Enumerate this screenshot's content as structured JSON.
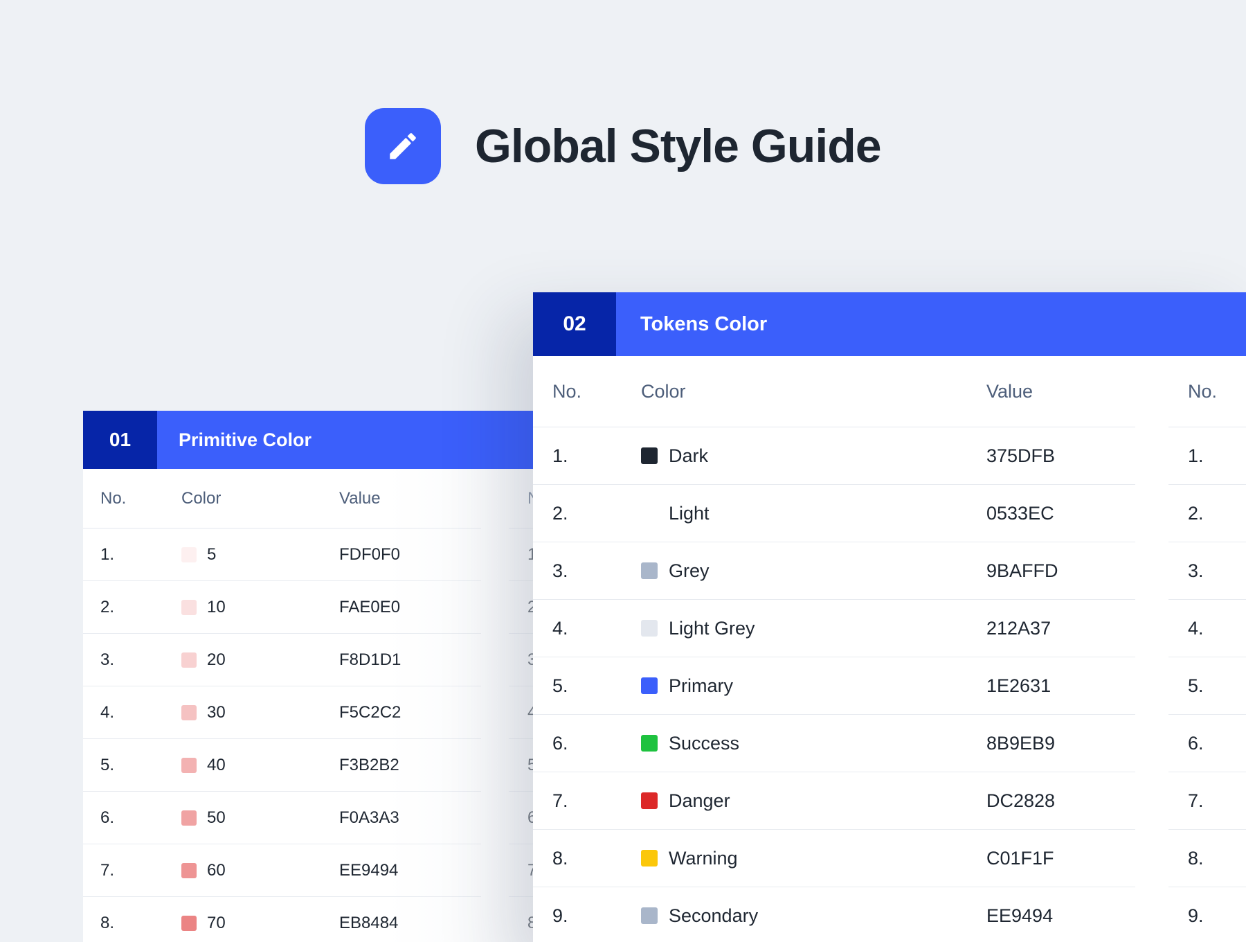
{
  "header": {
    "title": "Global Style Guide",
    "icon": "pencil-icon",
    "icon_bg": "#3b5ffb"
  },
  "primitive": {
    "number": "01",
    "title": "Primitive Color",
    "columns": {
      "no": "No.",
      "color": "Color",
      "value": "Value"
    },
    "rows": [
      {
        "no": "1.",
        "name": "5",
        "value": "FDF0F0",
        "swatch": "#fdf0f0"
      },
      {
        "no": "2.",
        "name": "10",
        "value": "FAE0E0",
        "swatch": "#fae0e0"
      },
      {
        "no": "3.",
        "name": "20",
        "value": "F8D1D1",
        "swatch": "#f8d1d1"
      },
      {
        "no": "4.",
        "name": "30",
        "value": "F5C2C2",
        "swatch": "#f5c2c2"
      },
      {
        "no": "5.",
        "name": "40",
        "value": "F3B2B2",
        "swatch": "#f3b2b2"
      },
      {
        "no": "6.",
        "name": "50",
        "value": "F0A3A3",
        "swatch": "#f0a3a3"
      },
      {
        "no": "7.",
        "name": "60",
        "value": "EE9494",
        "swatch": "#ee9494"
      },
      {
        "no": "8.",
        "name": "70",
        "value": "EB8484",
        "swatch": "#eb8484"
      }
    ],
    "second_table": {
      "header": "N",
      "numbers": [
        "1",
        "2",
        "3",
        "4",
        "5",
        "6",
        "7",
        "8"
      ]
    }
  },
  "tokens": {
    "number": "02",
    "title": "Tokens Color",
    "columns": {
      "no": "No.",
      "color": "Color",
      "value": "Value"
    },
    "rows": [
      {
        "no": "1.",
        "name": "Dark",
        "value": "375DFB",
        "swatch": "#1e2631"
      },
      {
        "no": "2.",
        "name": "Light",
        "value": "0533EC",
        "swatch": "#ffffff"
      },
      {
        "no": "3.",
        "name": "Grey",
        "value": "9BAFFD",
        "swatch": "#a9b6ca"
      },
      {
        "no": "4.",
        "name": "Light Grey",
        "value": "212A37",
        "swatch": "#e3e7ee"
      },
      {
        "no": "5.",
        "name": "Primary",
        "value": "1E2631",
        "swatch": "#3b5ffb"
      },
      {
        "no": "6.",
        "name": "Success",
        "value": "8B9EB9",
        "swatch": "#1ec23f"
      },
      {
        "no": "7.",
        "name": "Danger",
        "value": "DC2828",
        "swatch": "#dc2828"
      },
      {
        "no": "8.",
        "name": "Warning",
        "value": "C01F1F",
        "swatch": "#fbc70a"
      },
      {
        "no": "9.",
        "name": "Secondary",
        "value": "EE9494",
        "swatch": "#a9b6ca"
      }
    ],
    "second_table": {
      "header": "No.",
      "numbers": [
        "1.",
        "2.",
        "3.",
        "4.",
        "5.",
        "6.",
        "7.",
        "8.",
        "9."
      ]
    }
  }
}
